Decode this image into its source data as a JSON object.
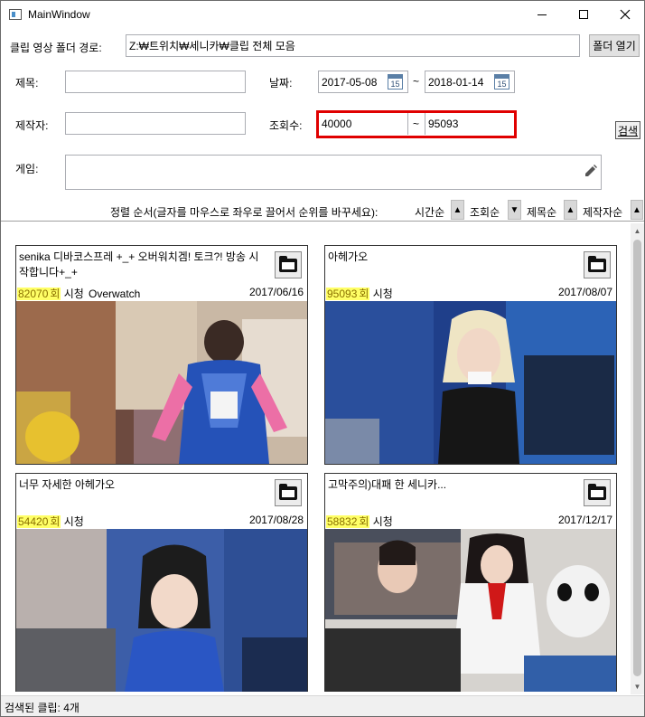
{
  "window": {
    "title": "MainWindow"
  },
  "filters": {
    "folder_label": "클립 영상 폴더 경로:",
    "folder_path": "Z:₩트위치₩세니카₩클립 전체 모음",
    "open_folder_label": "폴더 열기",
    "title_label": "제목:",
    "title_value": "",
    "date_label": "날짜:",
    "date_from": "2017-05-08",
    "date_to": "2018-01-14",
    "date_sep": "~",
    "calendar_day": "15",
    "author_label": "제작자:",
    "author_value": "",
    "views_label": "조회수:",
    "views_from": "40000",
    "views_to": "95093",
    "views_sep": "~",
    "search_label": "검색",
    "game_label": "게임:",
    "game_value": ""
  },
  "sort": {
    "label": "정렬 순서(글자를 마우스로 좌우로 끌어서 순위를 바꾸세요):",
    "items": [
      {
        "label": "시간순",
        "direction": "▲"
      },
      {
        "label": "조회순",
        "direction": "▼"
      },
      {
        "label": "제목순",
        "direction": "▲"
      },
      {
        "label": "제작자순",
        "direction": "▲"
      }
    ]
  },
  "views_suffix": "회",
  "watch_label": "시청",
  "clips": [
    {
      "title": "senika 디바코스프레 +_+ 오버워치겜! 토크?! 방송 시작합니다+_+",
      "views": "82070",
      "game": "Overwatch",
      "date": "2017/06/16"
    },
    {
      "title": "아헤가오",
      "views": "95093",
      "game": "",
      "date": "2017/08/07"
    },
    {
      "title": "너무 자세한 아헤가오",
      "views": "54420",
      "game": "",
      "date": "2017/08/28"
    },
    {
      "title": "고막주의)대패 한 세니카...",
      "views": "58832",
      "game": "",
      "date": "2017/12/17"
    }
  ],
  "status": {
    "text": "검색된 클립: 4개"
  },
  "colors": {
    "highlight": "#ffff66",
    "red_box": "#e00000"
  }
}
